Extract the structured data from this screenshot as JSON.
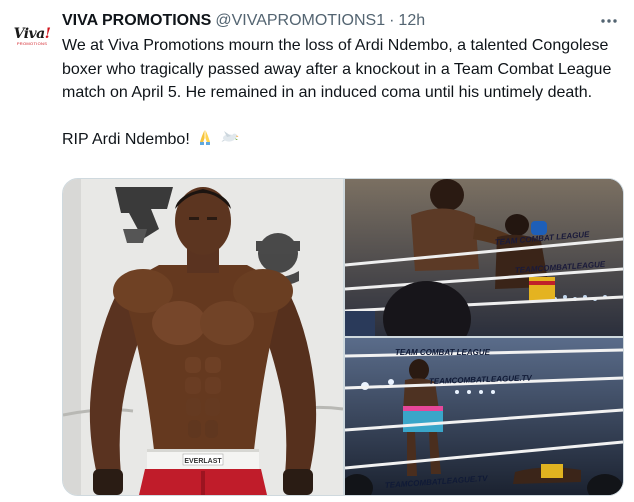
{
  "tweet": {
    "author_name": "VIVA PROMOTIONS",
    "author_handle": "@VIVAPROMOTIONS1",
    "separator": "·",
    "timestamp": "12h",
    "avatar_logo": "Viva!",
    "avatar_logo_sub": "PROMOTIONS",
    "body_paragraph_1": "We at Viva Promotions mourn the loss of Ardi Ndembo, a talented Congolese boxer who tragically passed away after a knockout in a Team Combat League match on April 5. He remained in an induced coma until his untimely death.",
    "body_paragraph_2": "RIP Ardi Ndembo!",
    "emojis": [
      "folded-hands",
      "dove"
    ]
  },
  "media": {
    "photo_left": {
      "waistband_text": "EVERLAST"
    },
    "photo_top_right": {
      "banner_1": "TEAM COMBAT LEAGUE",
      "banner_2": "TEAMCOMBATLEAGUE"
    },
    "photo_bottom_right": {
      "banner_1": "TEAM COMBAT LEAGUE",
      "banner_2": "TEAMCOMBATLEAGUE.TV",
      "banner_3": "TEAMCOMBATLEAGUE.TV"
    }
  },
  "colors": {
    "text_primary": "#0f1419",
    "text_secondary": "#536471",
    "border": "#cfd9de",
    "logo_red": "#d0141c"
  },
  "icons": [
    "more-options-icon",
    "folded-hands-emoji",
    "dove-emoji"
  ]
}
